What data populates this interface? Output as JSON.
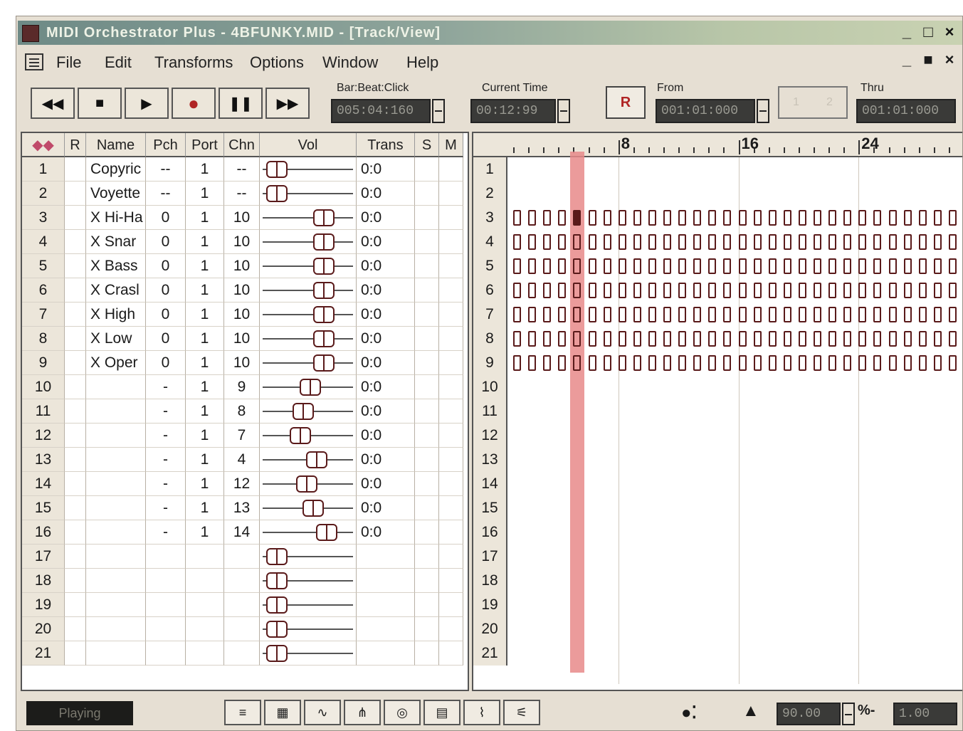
{
  "window": {
    "title": "MIDI Orchestrator Plus - 4BFUNKY.MID - [Track/View]",
    "controls": [
      "_",
      "□",
      "×"
    ],
    "mdi_controls": [
      "_",
      "■",
      "×"
    ]
  },
  "menu": [
    "File",
    "Edit",
    "Transforms",
    "Options",
    "Window",
    "Help"
  ],
  "toolbar": {
    "transport": [
      {
        "name": "rewind-button",
        "glyph": "◀◀"
      },
      {
        "name": "stop-button",
        "glyph": "■"
      },
      {
        "name": "play-button",
        "glyph": "▶"
      },
      {
        "name": "record-button",
        "glyph": "●"
      },
      {
        "name": "pause-button",
        "glyph": "❚❚"
      },
      {
        "name": "fast-forward-button",
        "glyph": "▶▶"
      }
    ],
    "bbc_label": "Bar:Beat:Click",
    "bbc_value": "005:04:160",
    "time_label": "Current Time",
    "time_value": "00:12:99",
    "r_button": "R",
    "from_label": "From",
    "from_value": "001:01:000",
    "grayed": [
      "1",
      "2"
    ],
    "thru_label": "Thru",
    "thru_value": "001:01:000"
  },
  "track_table": {
    "headers": [
      "",
      "R",
      "Name",
      "Pch",
      "Port",
      "Chn",
      "Vol",
      "Trans",
      "S",
      "M"
    ],
    "rows": [
      {
        "num": "1",
        "name": "Copyric",
        "pch": "--",
        "port": "1",
        "chn": "--",
        "vol": 0.05,
        "trans": "0:0"
      },
      {
        "num": "2",
        "name": "Voyette",
        "pch": "--",
        "port": "1",
        "chn": "--",
        "vol": 0.05,
        "trans": "0:0"
      },
      {
        "num": "3",
        "name": "X Hi-Ha",
        "pch": "0",
        "port": "1",
        "chn": "10",
        "vol": 0.75,
        "trans": "0:0"
      },
      {
        "num": "4",
        "name": "X Snar",
        "pch": "0",
        "port": "1",
        "chn": "10",
        "vol": 0.75,
        "trans": "0:0"
      },
      {
        "num": "5",
        "name": "X Bass",
        "pch": "0",
        "port": "1",
        "chn": "10",
        "vol": 0.75,
        "trans": "0:0"
      },
      {
        "num": "6",
        "name": "X Crasl",
        "pch": "0",
        "port": "1",
        "chn": "10",
        "vol": 0.75,
        "trans": "0:0"
      },
      {
        "num": "7",
        "name": "X High",
        "pch": "0",
        "port": "1",
        "chn": "10",
        "vol": 0.75,
        "trans": "0:0"
      },
      {
        "num": "8",
        "name": "X Low",
        "pch": "0",
        "port": "1",
        "chn": "10",
        "vol": 0.75,
        "trans": "0:0"
      },
      {
        "num": "9",
        "name": "X Oper",
        "pch": "0",
        "port": "1",
        "chn": "10",
        "vol": 0.75,
        "trans": "0:0"
      },
      {
        "num": "10",
        "name": "",
        "pch": "-",
        "port": "1",
        "chn": "9",
        "vol": 0.55,
        "trans": "0:0"
      },
      {
        "num": "11",
        "name": "",
        "pch": "-",
        "port": "1",
        "chn": "8",
        "vol": 0.45,
        "trans": "0:0"
      },
      {
        "num": "12",
        "name": "",
        "pch": "-",
        "port": "1",
        "chn": "7",
        "vol": 0.4,
        "trans": "0:0"
      },
      {
        "num": "13",
        "name": "",
        "pch": "-",
        "port": "1",
        "chn": "4",
        "vol": 0.65,
        "trans": "0:0"
      },
      {
        "num": "14",
        "name": "",
        "pch": "-",
        "port": "1",
        "chn": "12",
        "vol": 0.5,
        "trans": "0:0"
      },
      {
        "num": "15",
        "name": "",
        "pch": "-",
        "port": "1",
        "chn": "13",
        "vol": 0.6,
        "trans": "0:0"
      },
      {
        "num": "16",
        "name": "",
        "pch": "-",
        "port": "1",
        "chn": "14",
        "vol": 0.8,
        "trans": "0:0"
      },
      {
        "num": "17",
        "name": "",
        "pch": "",
        "port": "",
        "chn": "",
        "vol": 0.05,
        "trans": ""
      },
      {
        "num": "18",
        "name": "",
        "pch": "",
        "port": "",
        "chn": "",
        "vol": 0.05,
        "trans": ""
      },
      {
        "num": "19",
        "name": "",
        "pch": "",
        "port": "",
        "chn": "",
        "vol": 0.05,
        "trans": ""
      },
      {
        "num": "20",
        "name": "",
        "pch": "",
        "port": "",
        "chn": "",
        "vol": 0.05,
        "trans": ""
      },
      {
        "num": "21",
        "name": "",
        "pch": "",
        "port": "",
        "chn": "",
        "vol": 0.05,
        "trans": ""
      }
    ]
  },
  "arrange": {
    "ruler_labels": [
      {
        "bar": 8,
        "text": "8"
      },
      {
        "bar": 16,
        "text": "16"
      },
      {
        "bar": 24,
        "text": "24"
      }
    ],
    "row_numbers": [
      "1",
      "2",
      "3",
      "4",
      "5",
      "6",
      "7",
      "8",
      "9",
      "10",
      "11",
      "12",
      "13",
      "14",
      "15",
      "16",
      "17",
      "18",
      "19",
      "20",
      "21"
    ],
    "tracks_with_data": [
      3,
      4,
      5,
      6,
      7,
      8,
      9
    ],
    "bars_visible": 30,
    "playhead_bar": 5
  },
  "statusbar": {
    "status": "Playing",
    "view_buttons": [
      "staff-view-icon",
      "piano-roll-icon",
      "controller-icon",
      "event-list-icon",
      "drum-icon",
      "notepad-icon",
      "tempo-icon",
      "mixer-icon"
    ],
    "tempo": "90.00",
    "percent": "1.00"
  },
  "colors": {
    "accent": "#b02525",
    "playhead": "#e88a8a",
    "block": "#5a1a1a"
  }
}
